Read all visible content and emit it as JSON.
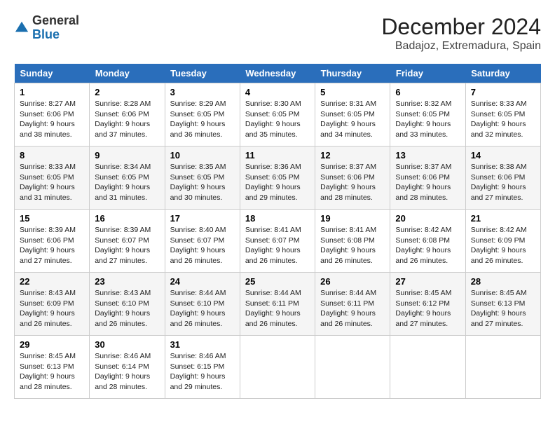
{
  "header": {
    "logo_general": "General",
    "logo_blue": "Blue",
    "month_title": "December 2024",
    "location": "Badajoz, Extremadura, Spain"
  },
  "calendar": {
    "days_of_week": [
      "Sunday",
      "Monday",
      "Tuesday",
      "Wednesday",
      "Thursday",
      "Friday",
      "Saturday"
    ],
    "weeks": [
      [
        {
          "day": "",
          "empty": true
        },
        {
          "day": "2",
          "sunrise": "8:28 AM",
          "sunset": "6:06 PM",
          "daylight": "9 hours and 37 minutes."
        },
        {
          "day": "3",
          "sunrise": "8:29 AM",
          "sunset": "6:05 PM",
          "daylight": "9 hours and 36 minutes."
        },
        {
          "day": "4",
          "sunrise": "8:30 AM",
          "sunset": "6:05 PM",
          "daylight": "9 hours and 35 minutes."
        },
        {
          "day": "5",
          "sunrise": "8:31 AM",
          "sunset": "6:05 PM",
          "daylight": "9 hours and 34 minutes."
        },
        {
          "day": "6",
          "sunrise": "8:32 AM",
          "sunset": "6:05 PM",
          "daylight": "9 hours and 33 minutes."
        },
        {
          "day": "7",
          "sunrise": "8:33 AM",
          "sunset": "6:05 PM",
          "daylight": "9 hours and 32 minutes."
        }
      ],
      [
        {
          "day": "8",
          "sunrise": "8:33 AM",
          "sunset": "6:05 PM",
          "daylight": "9 hours and 31 minutes."
        },
        {
          "day": "9",
          "sunrise": "8:34 AM",
          "sunset": "6:05 PM",
          "daylight": "9 hours and 31 minutes."
        },
        {
          "day": "10",
          "sunrise": "8:35 AM",
          "sunset": "6:05 PM",
          "daylight": "9 hours and 30 minutes."
        },
        {
          "day": "11",
          "sunrise": "8:36 AM",
          "sunset": "6:05 PM",
          "daylight": "9 hours and 29 minutes."
        },
        {
          "day": "12",
          "sunrise": "8:37 AM",
          "sunset": "6:06 PM",
          "daylight": "9 hours and 28 minutes."
        },
        {
          "day": "13",
          "sunrise": "8:37 AM",
          "sunset": "6:06 PM",
          "daylight": "9 hours and 28 minutes."
        },
        {
          "day": "14",
          "sunrise": "8:38 AM",
          "sunset": "6:06 PM",
          "daylight": "9 hours and 27 minutes."
        }
      ],
      [
        {
          "day": "15",
          "sunrise": "8:39 AM",
          "sunset": "6:06 PM",
          "daylight": "9 hours and 27 minutes."
        },
        {
          "day": "16",
          "sunrise": "8:39 AM",
          "sunset": "6:07 PM",
          "daylight": "9 hours and 27 minutes."
        },
        {
          "day": "17",
          "sunrise": "8:40 AM",
          "sunset": "6:07 PM",
          "daylight": "9 hours and 26 minutes."
        },
        {
          "day": "18",
          "sunrise": "8:41 AM",
          "sunset": "6:07 PM",
          "daylight": "9 hours and 26 minutes."
        },
        {
          "day": "19",
          "sunrise": "8:41 AM",
          "sunset": "6:08 PM",
          "daylight": "9 hours and 26 minutes."
        },
        {
          "day": "20",
          "sunrise": "8:42 AM",
          "sunset": "6:08 PM",
          "daylight": "9 hours and 26 minutes."
        },
        {
          "day": "21",
          "sunrise": "8:42 AM",
          "sunset": "6:09 PM",
          "daylight": "9 hours and 26 minutes."
        }
      ],
      [
        {
          "day": "22",
          "sunrise": "8:43 AM",
          "sunset": "6:09 PM",
          "daylight": "9 hours and 26 minutes."
        },
        {
          "day": "23",
          "sunrise": "8:43 AM",
          "sunset": "6:10 PM",
          "daylight": "9 hours and 26 minutes."
        },
        {
          "day": "24",
          "sunrise": "8:44 AM",
          "sunset": "6:10 PM",
          "daylight": "9 hours and 26 minutes."
        },
        {
          "day": "25",
          "sunrise": "8:44 AM",
          "sunset": "6:11 PM",
          "daylight": "9 hours and 26 minutes."
        },
        {
          "day": "26",
          "sunrise": "8:44 AM",
          "sunset": "6:11 PM",
          "daylight": "9 hours and 26 minutes."
        },
        {
          "day": "27",
          "sunrise": "8:45 AM",
          "sunset": "6:12 PM",
          "daylight": "9 hours and 27 minutes."
        },
        {
          "day": "28",
          "sunrise": "8:45 AM",
          "sunset": "6:13 PM",
          "daylight": "9 hours and 27 minutes."
        }
      ],
      [
        {
          "day": "29",
          "sunrise": "8:45 AM",
          "sunset": "6:13 PM",
          "daylight": "9 hours and 28 minutes."
        },
        {
          "day": "30",
          "sunrise": "8:46 AM",
          "sunset": "6:14 PM",
          "daylight": "9 hours and 28 minutes."
        },
        {
          "day": "31",
          "sunrise": "8:46 AM",
          "sunset": "6:15 PM",
          "daylight": "9 hours and 29 minutes."
        },
        {
          "day": "",
          "empty": true
        },
        {
          "day": "",
          "empty": true
        },
        {
          "day": "",
          "empty": true
        },
        {
          "day": "",
          "empty": true
        }
      ]
    ],
    "week1_sunday": {
      "day": "1",
      "sunrise": "8:27 AM",
      "sunset": "6:06 PM",
      "daylight": "9 hours and 38 minutes."
    }
  }
}
